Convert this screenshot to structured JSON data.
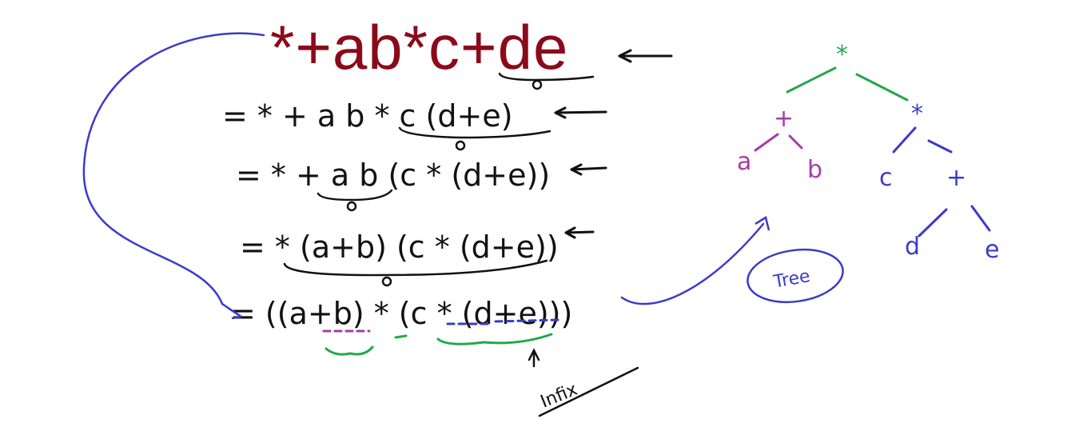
{
  "prefix_expression": "*+ab*c+de",
  "steps": [
    "= * + a b * c (d+e)",
    "= * + a b (c * (d+e))",
    "= * (a+b) (c * (d+e))",
    "= ((a+b) * (c * (d+e)))"
  ],
  "infix_label": "Infix",
  "tree_label": "Tree",
  "tree_nodes": {
    "root": "*",
    "left": "+",
    "right": "*",
    "ll": "a",
    "lr": "b",
    "rl": "c",
    "rr": "+",
    "rrl": "d",
    "rrr": "e"
  },
  "colors": {
    "title": "#8b0a1a",
    "ink": "#111111",
    "blue": "#3b3bc8",
    "green": "#22a84a",
    "purple": "#a63ca6"
  }
}
